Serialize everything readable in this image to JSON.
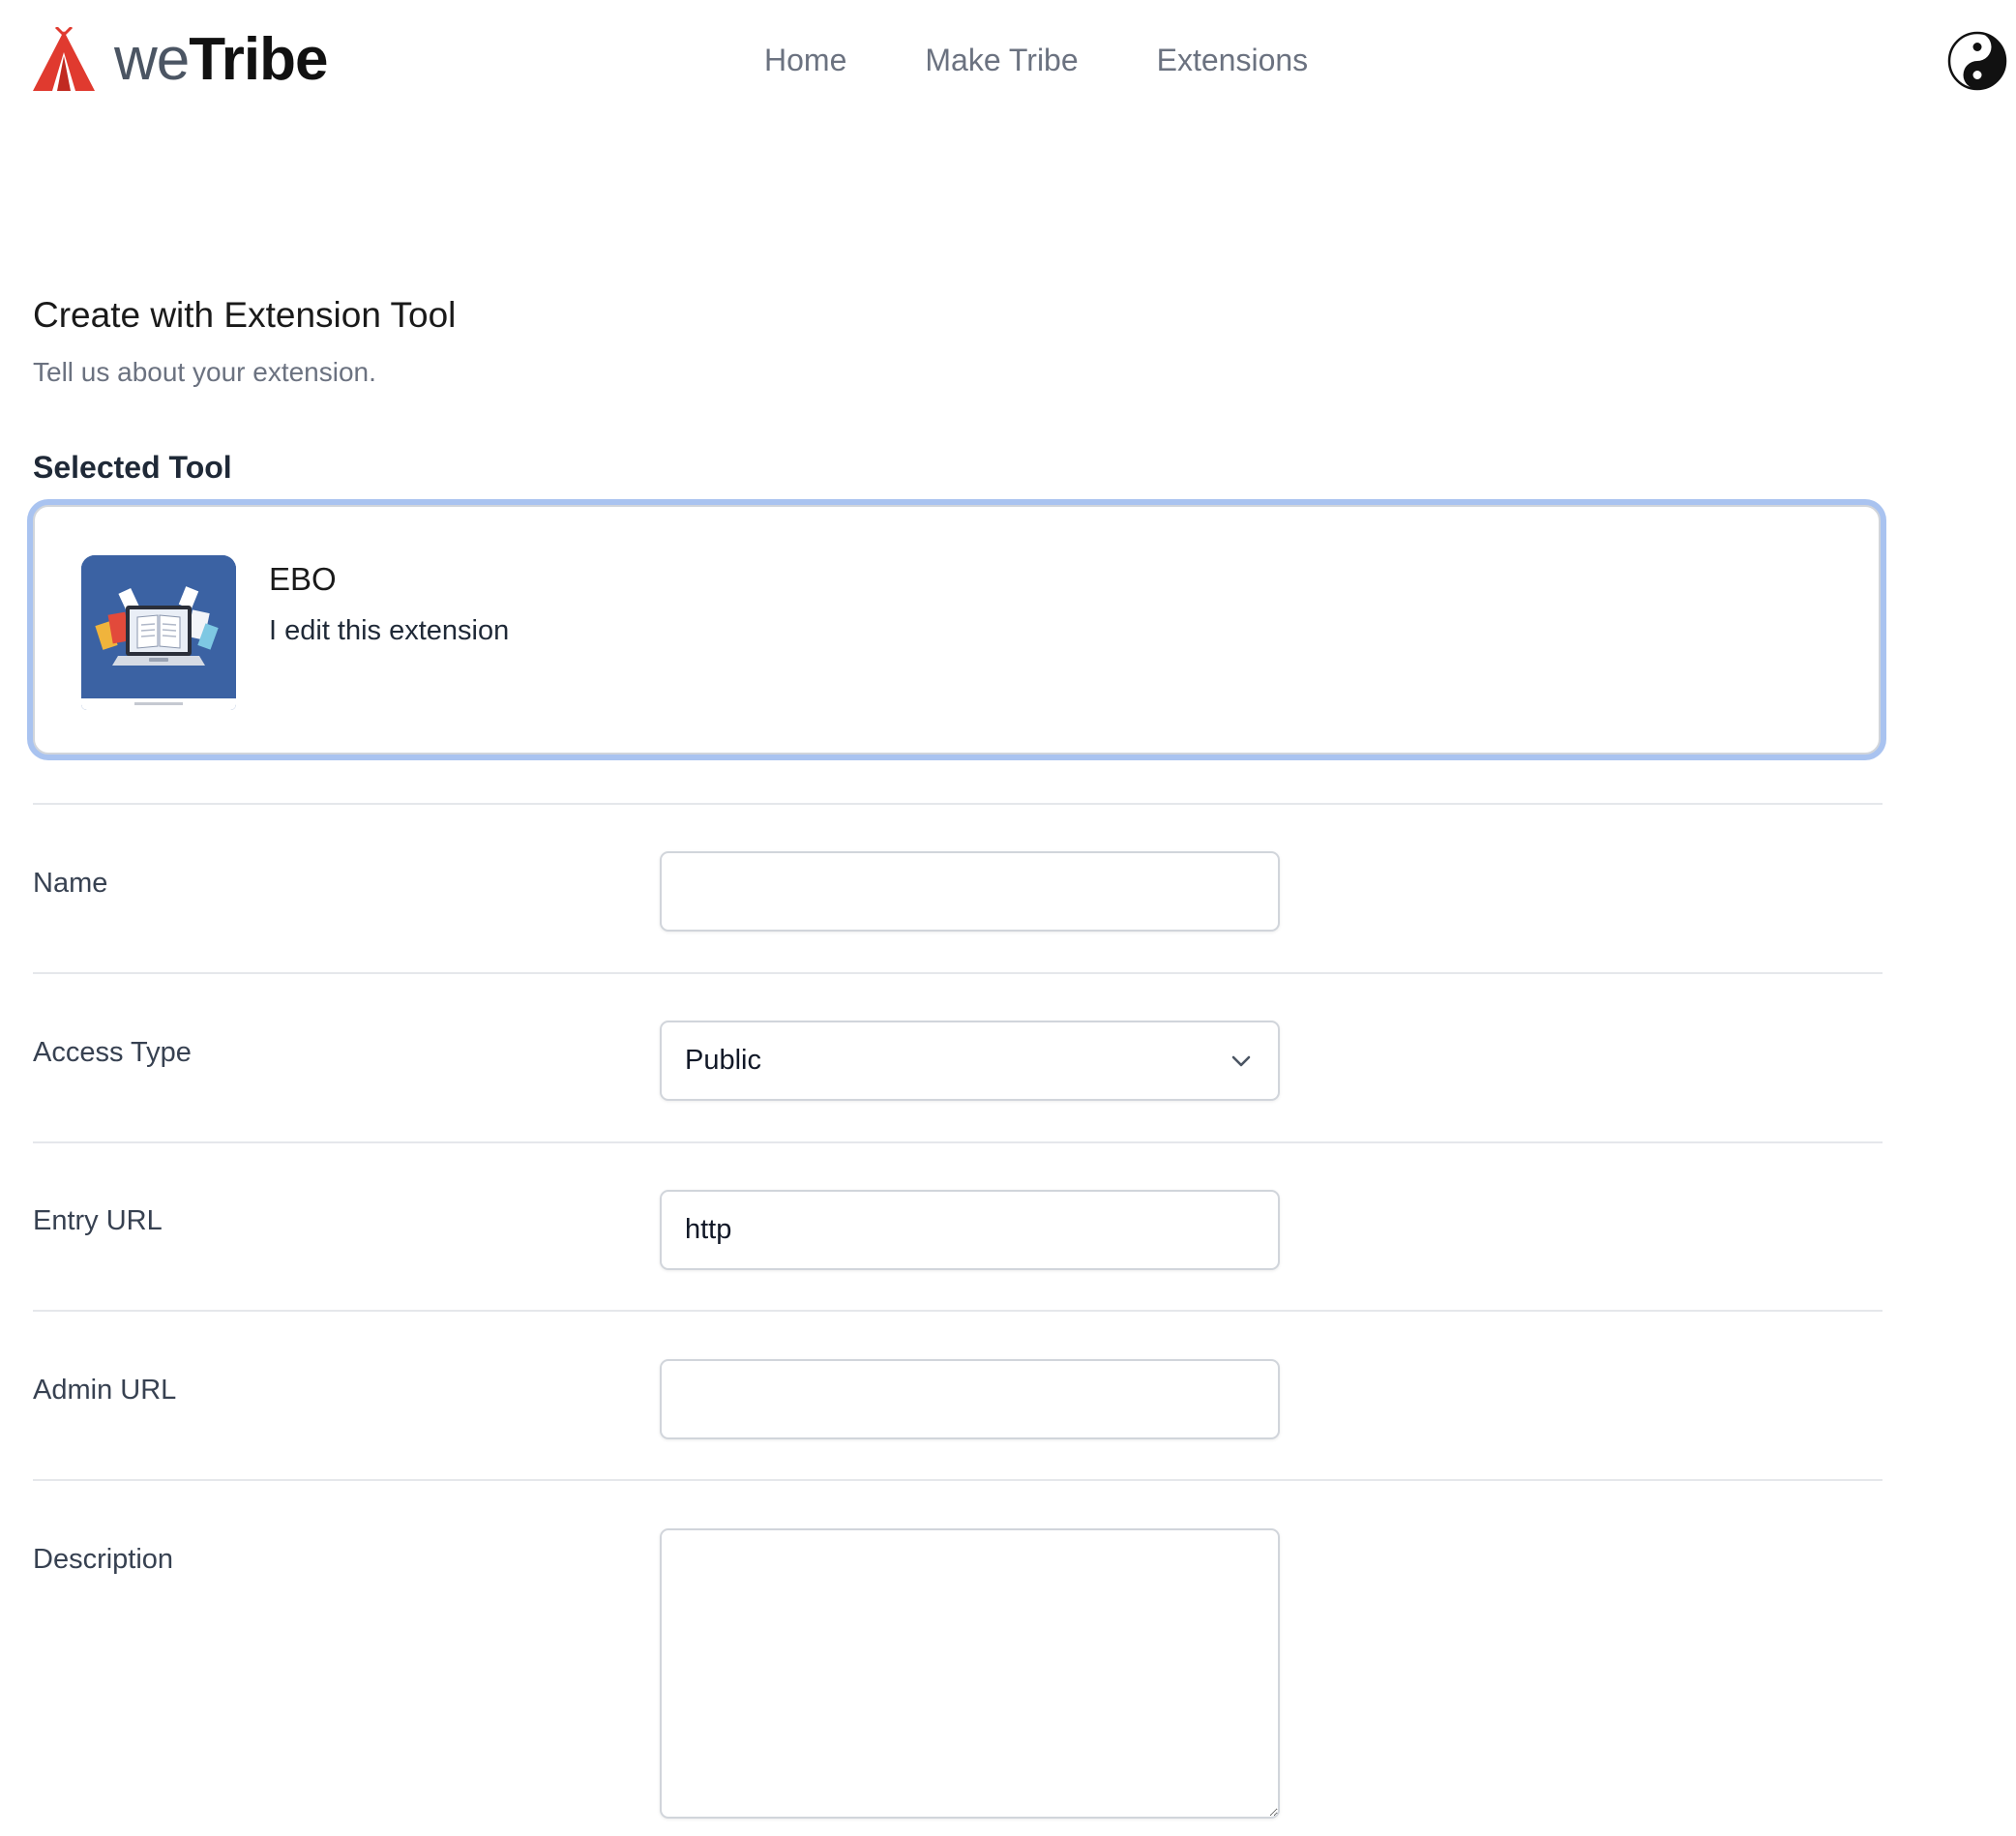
{
  "header": {
    "logo": {
      "text_light": "we",
      "text_bold": "Tribe",
      "icon": "tent-logo-icon",
      "brand_color": "#e03a2f"
    },
    "nav": [
      {
        "label": "Home"
      },
      {
        "label": "Make Tribe"
      },
      {
        "label": "Extensions"
      }
    ],
    "theme_toggle_icon": "yin-yang-icon"
  },
  "page": {
    "title": "Create with Extension Tool",
    "subtitle": "Tell us about your extension."
  },
  "selected_tool": {
    "heading": "Selected Tool",
    "name": "EBO",
    "description": "I edit this extension",
    "thumbnail_icon": "laptop-books-icon",
    "thumbnail_bg": "#3b62a3",
    "focus_ring_color": "#a9c3f0"
  },
  "form": {
    "name": {
      "label": "Name",
      "value": ""
    },
    "access_type": {
      "label": "Access Type",
      "value": "Public"
    },
    "entry_url": {
      "label": "Entry URL",
      "value": "http"
    },
    "admin_url": {
      "label": "Admin URL",
      "value": ""
    },
    "description": {
      "label": "Description",
      "value": ""
    }
  }
}
